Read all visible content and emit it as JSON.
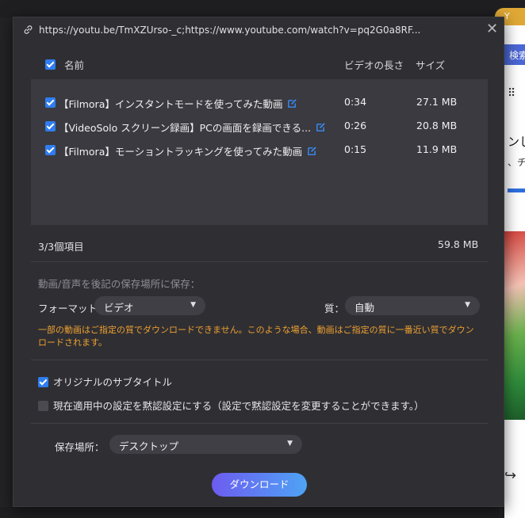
{
  "background": {
    "chip_label": "Y",
    "search_label": "検索",
    "side_text_1": "ンし",
    "side_text_2": "、チ さい",
    "grid_icon": "apps-grid-icon",
    "share_icon": "share-icon"
  },
  "dialog": {
    "url": "https://youtu.be/TmXZUrso-_c;https://www.youtube.com/watch?v=pq2G0a8RF...",
    "close_glyph": "✕",
    "headers": {
      "name": "名前",
      "duration": "ビデオの長さ",
      "size": "サイズ"
    },
    "items": [
      {
        "title": "【Filmora】インスタントモードを使ってみた動画",
        "duration": "0:34",
        "size": "27.1 MB",
        "checked": true
      },
      {
        "title": "【VideoSolo スクリーン録画】PCの画面を録画できる...",
        "duration": "0:26",
        "size": "20.8 MB",
        "checked": true
      },
      {
        "title": "【Filmora】モーショントラッキングを使ってみた動画",
        "duration": "0:15",
        "size": "11.9 MB",
        "checked": true
      }
    ],
    "summary_count": "3/3個項目",
    "summary_size": "59.8 MB",
    "save_label": "動画/音声を後記の保存場所に保存：",
    "format_label": "フォーマット：",
    "format_value": "ビデオ",
    "quality_label": "質：",
    "quality_value": "自動",
    "warning": "一部の動画はご指定の質でダウンロードできません。このような場合、動画はご指定の質に一番近い質でダウンロードされます。",
    "option_subtitle": "オリジナルのサブタイトル",
    "option_subtitle_checked": true,
    "option_default": "現在適用中の設定を黙認設定にする（設定で黙認設定を変更することができます。）",
    "option_default_checked": false,
    "location_label": "保存場所：",
    "location_value": "デスクトップ",
    "download_button": "ダウンロード",
    "accent_color": "#2f7df0",
    "warning_color": "#f0a030"
  }
}
